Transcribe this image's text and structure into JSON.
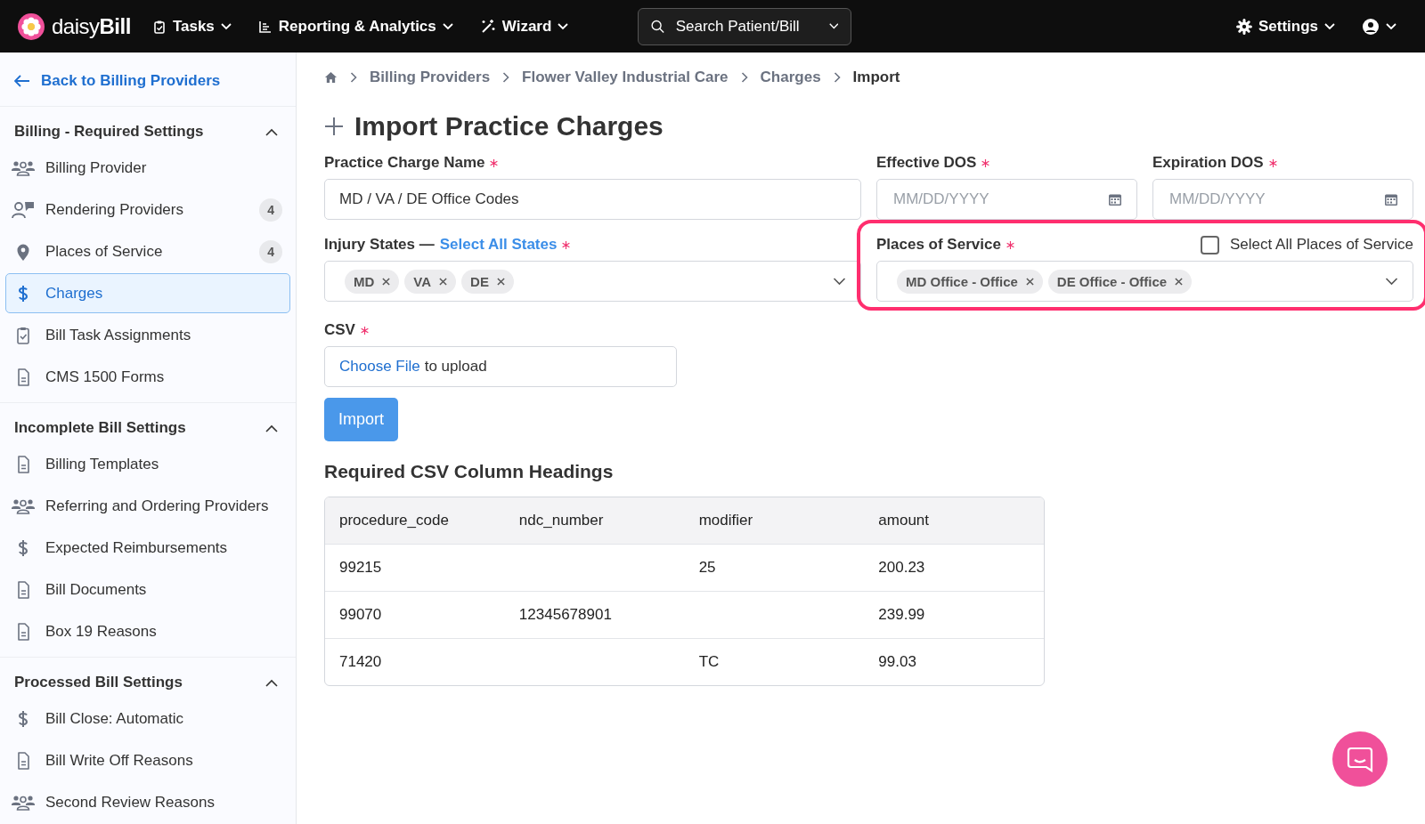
{
  "topbar": {
    "logo": "daisy**Bill**",
    "menus": [
      {
        "label": "Tasks",
        "kind": "tasks"
      },
      {
        "label": "Reporting & Analytics",
        "kind": "reports"
      },
      {
        "label": "Wizard",
        "kind": "wizard"
      }
    ],
    "search": {
      "placeholder": "Search Patient/Bill"
    },
    "settings": "Settings"
  },
  "sidebar": {
    "back": "Back to Billing Providers",
    "sections": [
      {
        "title": "Billing - Required Settings",
        "expanded": true,
        "items": [
          {
            "label": "Billing Provider",
            "kind": "people",
            "selected": false
          },
          {
            "label": "Rendering Providers",
            "kind": "provider",
            "count": "4",
            "selected": false
          },
          {
            "label": "Places of Service",
            "kind": "pin",
            "count": "4",
            "selected": false
          },
          {
            "label": "Charges",
            "kind": "dollar",
            "selected": true
          },
          {
            "label": "Bill Task Assignments",
            "kind": "clipboard",
            "selected": false
          },
          {
            "label": "CMS 1500 Forms",
            "kind": "doc",
            "selected": false
          }
        ]
      },
      {
        "title": "Incomplete Bill Settings",
        "expanded": true,
        "items": [
          {
            "label": "Billing Templates",
            "kind": "doc",
            "selected": false
          },
          {
            "label": "Referring and Ordering Providers",
            "kind": "people",
            "selected": false
          },
          {
            "label": "Expected Reimbursements",
            "kind": "dollar",
            "selected": false
          },
          {
            "label": "Bill Documents",
            "kind": "doc",
            "selected": false
          },
          {
            "label": "Box 19 Reasons",
            "kind": "doc",
            "selected": false
          }
        ]
      },
      {
        "title": "Processed Bill Settings",
        "expanded": true,
        "items": [
          {
            "label": "Bill Close: Automatic",
            "kind": "dollar",
            "selected": false
          },
          {
            "label": "Bill Write Off Reasons",
            "kind": "doc",
            "selected": false
          },
          {
            "label": "Second Review Reasons",
            "kind": "people",
            "selected": false
          }
        ]
      }
    ]
  },
  "breadcrumbs": [
    "Billing Providers",
    "Flower Valley Industrial Care",
    "Charges",
    "Import"
  ],
  "title": "Import Practice Charges",
  "form": {
    "name": {
      "label": "Practice Charge Name",
      "required": true,
      "value": "MD / VA / DE Office Codes"
    },
    "effective": {
      "label": "Effective DOS",
      "required": true,
      "placeholder": "MM/DD/YYYY"
    },
    "expiration": {
      "label": "Expiration DOS",
      "required": true,
      "placeholder": "MM/DD/YYYY"
    },
    "states": {
      "label": "Injury States —",
      "link": "Select All States",
      "required": true,
      "tags": [
        "MD",
        "VA",
        "DE"
      ]
    },
    "places": {
      "label": "Places of Service",
      "required": true,
      "highlighted": true,
      "select_all": {
        "label": "Select All Places of Service",
        "checked": false
      },
      "tags": [
        "MD Office - Office",
        "DE Office - Office"
      ]
    },
    "csv": {
      "label": "CSV",
      "required": true,
      "choose": "Choose File",
      "hint": "to upload"
    },
    "import_button": "Import"
  },
  "csv_headings": {
    "title": "Required CSV Column Headings",
    "columns": [
      "procedure_code",
      "ndc_number",
      "modifier",
      "amount"
    ],
    "rows": [
      [
        "99215",
        "",
        "25",
        "200.23"
      ],
      [
        "99070",
        "12345678901",
        "",
        "239.99"
      ],
      [
        "71420",
        "",
        "TC",
        "99.03"
      ]
    ]
  }
}
